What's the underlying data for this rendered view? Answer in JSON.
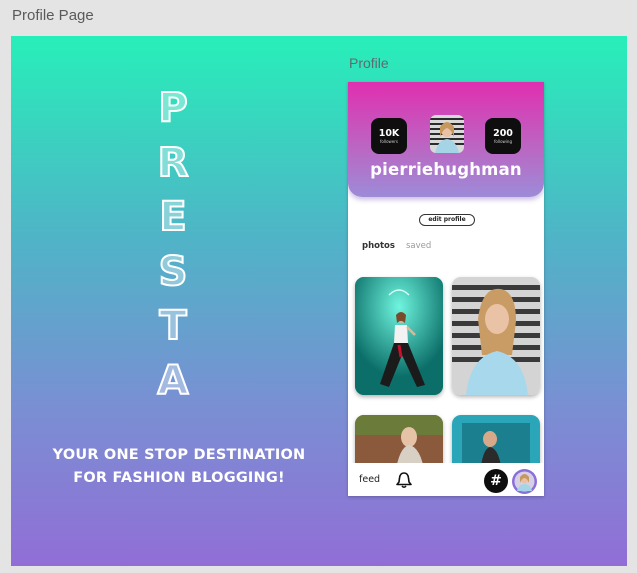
{
  "canvas": {
    "title": "Profile Page"
  },
  "brand": {
    "letters": [
      "P",
      "R",
      "E",
      "S",
      "T",
      "A"
    ]
  },
  "tagline": {
    "line1": "YOUR ONE STOP DESTINATION",
    "line2": "FOR FASHION BLOGGING!"
  },
  "artboard": {
    "label": "Profile"
  },
  "profile": {
    "followers_count": "10K",
    "followers_label": "followers",
    "following_count": "200",
    "following_label": "following",
    "username": "pierriehughman",
    "edit_label": "edit profile"
  },
  "tabs": {
    "photos": "photos",
    "saved": "saved"
  },
  "nav": {
    "feed": "feed",
    "hashtag": "#"
  },
  "colors": {
    "bg_top": "#27efb9",
    "bg_bottom": "#916ed6",
    "header_top": "#e02fb0",
    "header_bottom": "#9d8bd8",
    "stat_box": "#0e0e0e"
  },
  "icons": [
    "bell-icon",
    "hashtag-icon",
    "avatar"
  ]
}
